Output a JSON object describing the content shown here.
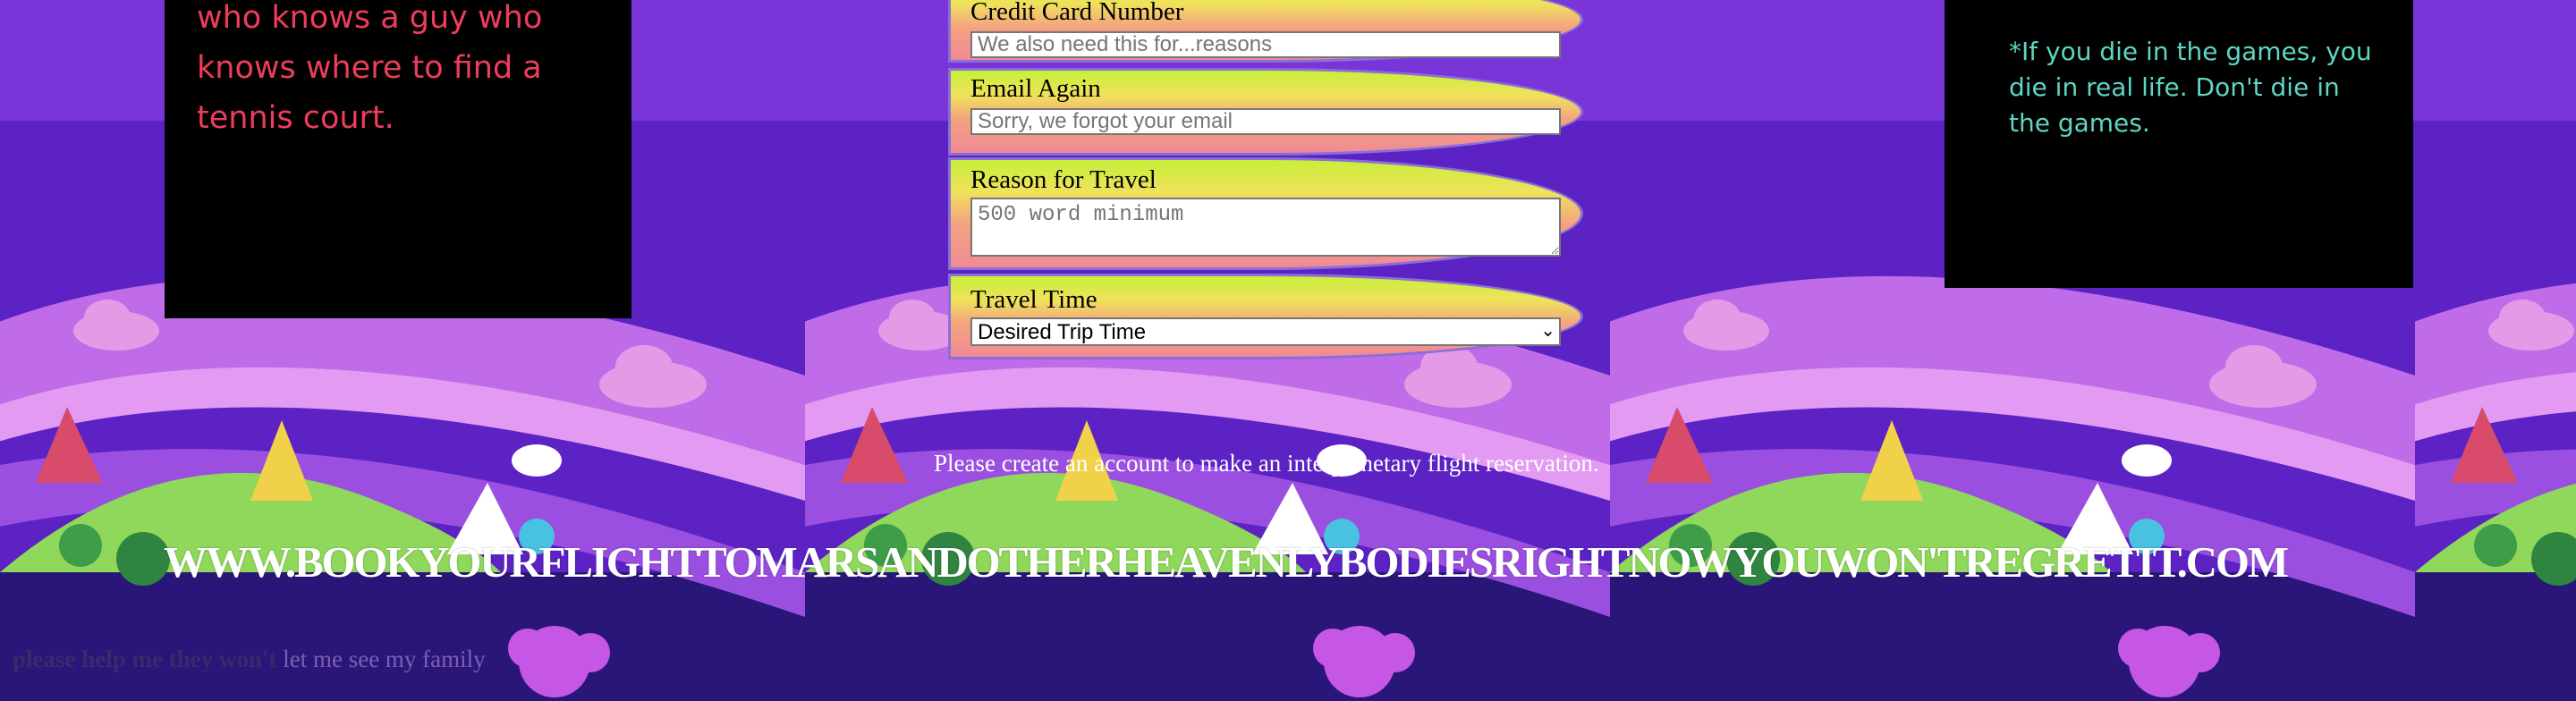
{
  "left_card": {
    "quote": "who knows a guy who knows where to find a tennis court."
  },
  "form": {
    "fields": [
      {
        "label": "Credit Card Number",
        "type": "text",
        "placeholder": "We also need this for...reasons"
      },
      {
        "label": "Email Again",
        "type": "text",
        "placeholder": "Sorry, we forgot your email"
      },
      {
        "label": "Reason for Travel",
        "type": "textarea",
        "placeholder": "500 word minimum"
      },
      {
        "label": "Travel Time",
        "type": "select",
        "selected": "Desired Trip Time"
      }
    ]
  },
  "right_card": {
    "note": "*If you die in the games, you die in real life. Don't die in the games."
  },
  "prompt_text": "Please create an account to make an interplanetary flight reservation.",
  "domain_text": "WWW.BOOKYOURFLIGHTTOMARSANDOTHERHEAVENLYBODIESRIGHTNOWYOUWON'TREGRETIT.COM",
  "footer": {
    "bold": "please help me they won't",
    "faint": "let me see my family"
  },
  "colors": {
    "quote": "#ee3d5a",
    "note": "#5fd6c4",
    "field_gradient": [
      "#c8ef39",
      "#f0e25c",
      "#f3a280",
      "#f08a96"
    ]
  }
}
